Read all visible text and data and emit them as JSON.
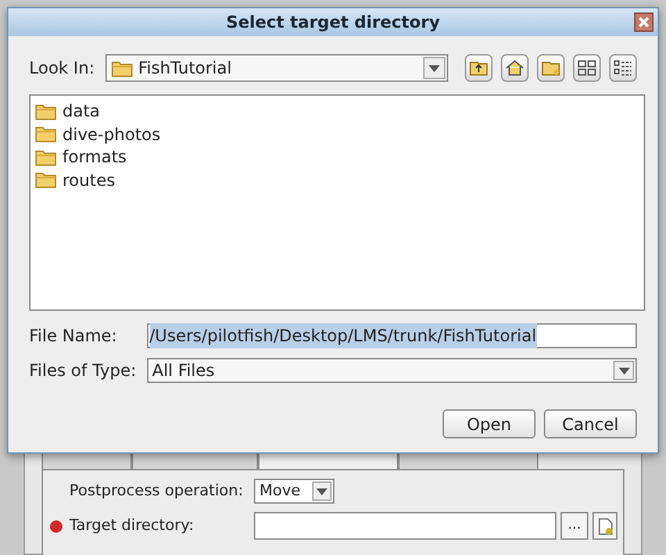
{
  "background_window": {
    "tabs": [
      {
        "selected": false
      },
      {
        "selected": false
      },
      {
        "selected": true
      },
      {
        "selected": false
      }
    ],
    "postprocess_operation": {
      "label": "Postprocess operation:",
      "value": "Move"
    },
    "target_directory": {
      "label": "Target directory:",
      "required": true,
      "browse_button": "..."
    }
  },
  "dialog": {
    "title": "Select target directory",
    "look_in": {
      "label": "Look In:",
      "value": "FishTutorial"
    },
    "files": [
      {
        "name": "data"
      },
      {
        "name": "dive-photos"
      },
      {
        "name": "formats"
      },
      {
        "name": "routes"
      }
    ],
    "file_name": {
      "label": "File Name:",
      "value": "/Users/pilotfish/Desktop/LMS/trunk/FishTutorial",
      "text_selected": true
    },
    "files_of_type": {
      "label": "Files of Type:",
      "value": "All Files"
    },
    "buttons": [
      "Open",
      "Cancel"
    ]
  }
}
